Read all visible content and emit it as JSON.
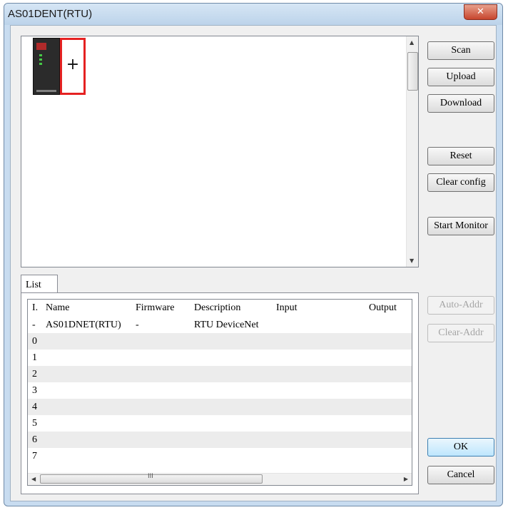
{
  "window": {
    "title": "AS01DENT(RTU)",
    "close_glyph": "✕"
  },
  "canvas": {
    "slot_glyph": "+",
    "scroll_up": "▲",
    "scroll_down": "▼"
  },
  "buttons": {
    "scan": "Scan",
    "upload": "Upload",
    "download": "Download",
    "reset": "Reset",
    "clear_config": "Clear config",
    "start_monitor": "Start Monitor",
    "auto_addr": "Auto-Addr",
    "clear_addr": "Clear-Addr",
    "ok": "OK",
    "cancel": "Cancel"
  },
  "list": {
    "tab_label": "List",
    "columns": [
      "I.",
      "Name",
      "Firmware",
      "Description",
      "Input",
      "Output"
    ],
    "rows": [
      [
        "-",
        "AS01DNET(RTU)",
        "-",
        "RTU DeviceNet",
        "",
        ""
      ],
      [
        "0",
        "",
        "",
        "",
        "",
        ""
      ],
      [
        "1",
        "",
        "",
        "",
        "",
        ""
      ],
      [
        "2",
        "",
        "",
        "",
        "",
        ""
      ],
      [
        "3",
        "",
        "",
        "",
        "",
        ""
      ],
      [
        "4",
        "",
        "",
        "",
        "",
        ""
      ],
      [
        "5",
        "",
        "",
        "",
        "",
        ""
      ],
      [
        "6",
        "",
        "",
        "",
        "",
        ""
      ],
      [
        "7",
        "",
        "",
        "",
        "",
        ""
      ]
    ],
    "scroll_left": "◀",
    "scroll_right": "▶",
    "grip": "III"
  }
}
